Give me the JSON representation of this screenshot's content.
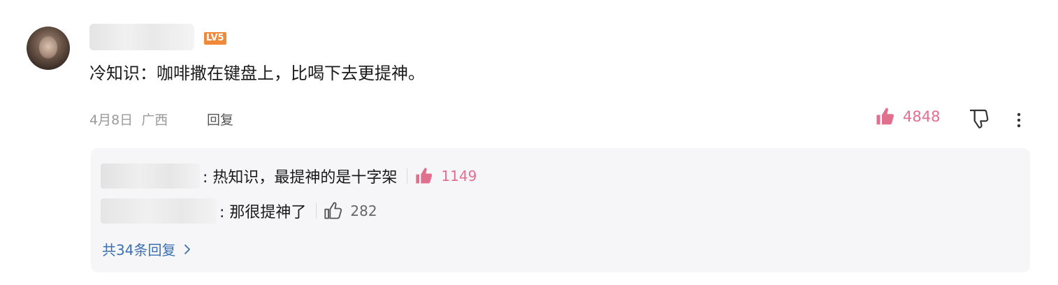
{
  "comment": {
    "level_badge": "LV5",
    "text": "冷知识：咖啡撒在键盘上，比喝下去更提神。",
    "date": "4月8日",
    "location": "广西",
    "reply_label": "回复",
    "like_count": "4848"
  },
  "replies": [
    {
      "text": ": 热知识，最提神的是十字架",
      "like_count": "1149",
      "liked": true
    },
    {
      "text": ": 那很提神了",
      "like_count": "282",
      "liked": false
    }
  ],
  "more_replies_label": "共34条回复",
  "colors": {
    "liked_pink": "#e0708e",
    "badge_orange": "#f08a3a",
    "link_blue": "#3b6fb0",
    "muted_gray": "#9a9a9a"
  },
  "icons": [
    "thumbs-up-filled-icon",
    "thumbs-down-icon",
    "more-vertical-icon",
    "thumbs-up-outline-icon",
    "chevron-right-icon"
  ]
}
